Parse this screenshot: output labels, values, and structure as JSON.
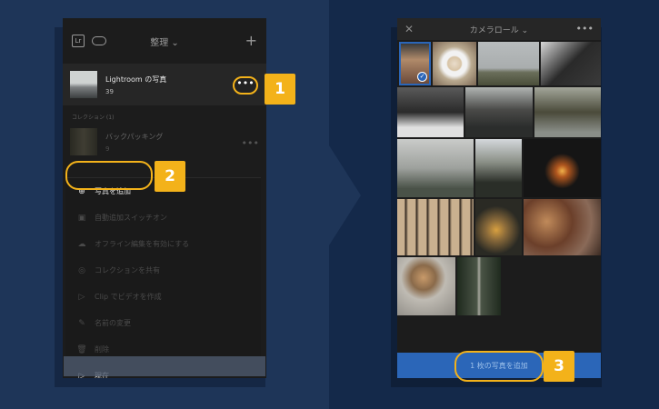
{
  "left_panel": {
    "header": {
      "logo": "Lr",
      "sort_label": "整理 ⌄",
      "add_icon": "plus-icon"
    },
    "album": {
      "name": "Lightroom の写真",
      "count": "39"
    },
    "collections_label": "コレクション (1)",
    "collection": {
      "name": "バックパッキング",
      "count": "9"
    },
    "menu": [
      {
        "label": "写真を追加",
        "icon": "⊕",
        "state": "active"
      },
      {
        "label": "自動追加スイッチオン",
        "icon": "▣",
        "state": "dim"
      },
      {
        "label": "オフライン編集を有効にする",
        "icon": "☁",
        "state": "dim"
      },
      {
        "label": "コレクションを共有",
        "icon": "◎",
        "state": "dim"
      },
      {
        "label": "Clip でビデオを作成",
        "icon": "▷",
        "state": "dim"
      },
      {
        "label": "名前の変更",
        "icon": "✎",
        "state": "dim"
      },
      {
        "label": "削除",
        "icon": "🗑",
        "state": "dim"
      },
      {
        "label": "現在",
        "icon": "▷",
        "state": "active"
      }
    ]
  },
  "right_panel": {
    "header": {
      "title": "カメラロール ⌄"
    },
    "add_button": "1 枚の写真を追加"
  },
  "badges": {
    "one": "1",
    "two": "2",
    "three": "3"
  },
  "colors": {
    "accent": "#f3b21a",
    "blue": "#2b66b8"
  }
}
